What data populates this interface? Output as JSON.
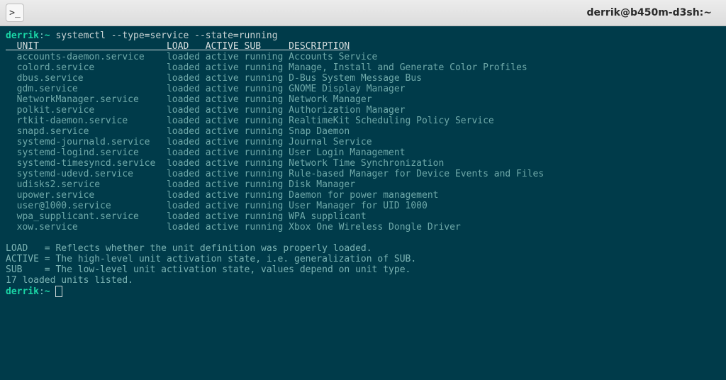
{
  "window": {
    "title": "derrik@b450m-d3sh:~",
    "icon_char": ">_"
  },
  "prompt": {
    "user": "derrik",
    "sep": ":",
    "path": "~",
    "command": "systemctl --type=service --state=running"
  },
  "headers": {
    "unit": "UNIT",
    "load": "LOAD",
    "active": "ACTIVE",
    "sub": "SUB",
    "description": "DESCRIPTION"
  },
  "rows": [
    {
      "unit": "accounts-daemon.service",
      "load": "loaded",
      "active": "active",
      "sub": "running",
      "description": "Accounts Service"
    },
    {
      "unit": "colord.service",
      "load": "loaded",
      "active": "active",
      "sub": "running",
      "description": "Manage, Install and Generate Color Profiles"
    },
    {
      "unit": "dbus.service",
      "load": "loaded",
      "active": "active",
      "sub": "running",
      "description": "D-Bus System Message Bus"
    },
    {
      "unit": "gdm.service",
      "load": "loaded",
      "active": "active",
      "sub": "running",
      "description": "GNOME Display Manager"
    },
    {
      "unit": "NetworkManager.service",
      "load": "loaded",
      "active": "active",
      "sub": "running",
      "description": "Network Manager"
    },
    {
      "unit": "polkit.service",
      "load": "loaded",
      "active": "active",
      "sub": "running",
      "description": "Authorization Manager"
    },
    {
      "unit": "rtkit-daemon.service",
      "load": "loaded",
      "active": "active",
      "sub": "running",
      "description": "RealtimeKit Scheduling Policy Service"
    },
    {
      "unit": "snapd.service",
      "load": "loaded",
      "active": "active",
      "sub": "running",
      "description": "Snap Daemon"
    },
    {
      "unit": "systemd-journald.service",
      "load": "loaded",
      "active": "active",
      "sub": "running",
      "description": "Journal Service"
    },
    {
      "unit": "systemd-logind.service",
      "load": "loaded",
      "active": "active",
      "sub": "running",
      "description": "User Login Management"
    },
    {
      "unit": "systemd-timesyncd.service",
      "load": "loaded",
      "active": "active",
      "sub": "running",
      "description": "Network Time Synchronization"
    },
    {
      "unit": "systemd-udevd.service",
      "load": "loaded",
      "active": "active",
      "sub": "running",
      "description": "Rule-based Manager for Device Events and Files"
    },
    {
      "unit": "udisks2.service",
      "load": "loaded",
      "active": "active",
      "sub": "running",
      "description": "Disk Manager"
    },
    {
      "unit": "upower.service",
      "load": "loaded",
      "active": "active",
      "sub": "running",
      "description": "Daemon for power management"
    },
    {
      "unit": "user@1000.service",
      "load": "loaded",
      "active": "active",
      "sub": "running",
      "description": "User Manager for UID 1000"
    },
    {
      "unit": "wpa_supplicant.service",
      "load": "loaded",
      "active": "active",
      "sub": "running",
      "description": "WPA supplicant"
    },
    {
      "unit": "xow.service",
      "load": "loaded",
      "active": "active",
      "sub": "running",
      "description": "Xbox One Wireless Dongle Driver"
    }
  ],
  "legend": {
    "load": "LOAD   = Reflects whether the unit definition was properly loaded.",
    "active": "ACTIVE = The high-level unit activation state, i.e. generalization of SUB.",
    "sub": "SUB    = The low-level unit activation state, values depend on unit type.",
    "summary": "17 loaded units listed."
  }
}
